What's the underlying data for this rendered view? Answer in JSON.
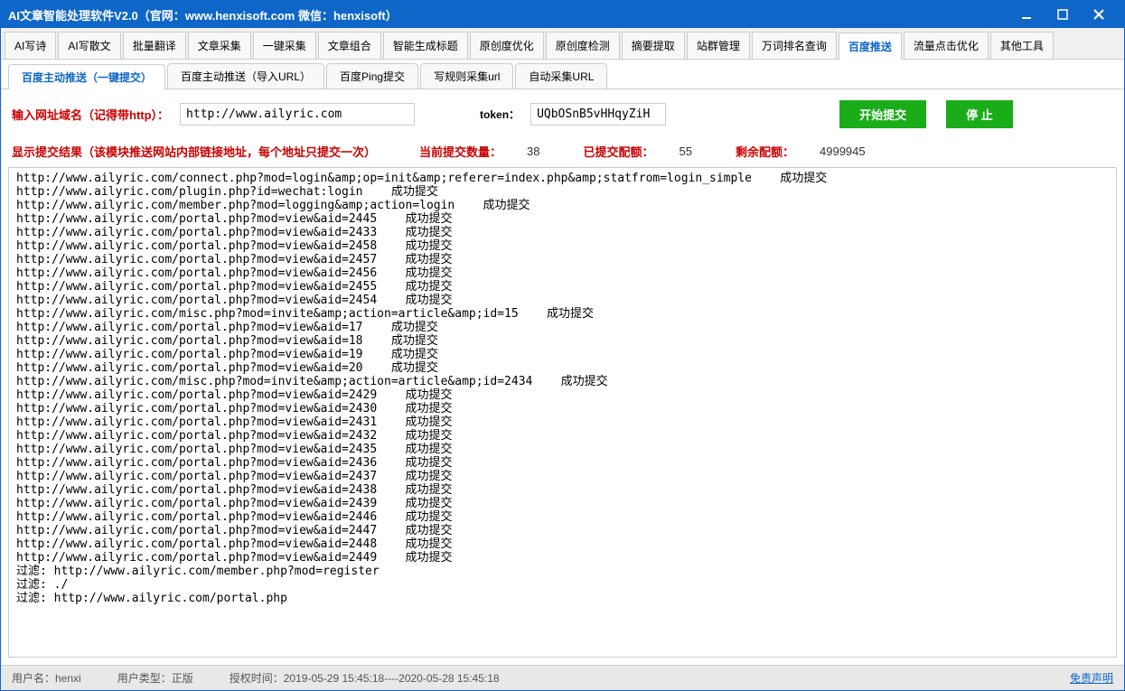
{
  "title": "AI文章智能处理软件V2.0（官网：www.henxisoft.com  微信：henxisoft）",
  "mainTabs": [
    "AI写诗",
    "AI写散文",
    "批量翻译",
    "文章采集",
    "一键采集",
    "文章组合",
    "智能生成标题",
    "原创度优化",
    "原创度检测",
    "摘要提取",
    "站群管理",
    "万词排名查询",
    "百度推送",
    "流量点击优化",
    "其他工具"
  ],
  "mainTabActive": 12,
  "subTabs": [
    "百度主动推送（一键提交）",
    "百度主动推送（导入URL）",
    "百度Ping提交",
    "写规则采集url",
    "自动采集URL"
  ],
  "subTabActive": 0,
  "form": {
    "urlLabel": "输入网址域名（记得带http）：",
    "urlValue": "http://www.ailyric.com",
    "tokenLabel": "token：",
    "tokenValue": "UQbOSnB5vHHqyZiH",
    "startBtn": "开始提交",
    "stopBtn": "停  止"
  },
  "stats": {
    "resultLabel": "显示提交结果（该模块推送网站内部链接地址，每个地址只提交一次）",
    "currentLabel": "当前提交数量：",
    "currentValue": "38",
    "submittedLabel": "已提交配额：",
    "submittedValue": "55",
    "remainLabel": "剩余配额：",
    "remainValue": "4999945"
  },
  "logLines": [
    "http://www.ailyric.com/connect.php?mod=login&amp;op=init&amp;referer=index.php&amp;statfrom=login_simple    成功提交",
    "http://www.ailyric.com/plugin.php?id=wechat:login    成功提交",
    "http://www.ailyric.com/member.php?mod=logging&amp;action=login    成功提交",
    "http://www.ailyric.com/portal.php?mod=view&aid=2445    成功提交",
    "http://www.ailyric.com/portal.php?mod=view&aid=2433    成功提交",
    "http://www.ailyric.com/portal.php?mod=view&aid=2458    成功提交",
    "http://www.ailyric.com/portal.php?mod=view&aid=2457    成功提交",
    "http://www.ailyric.com/portal.php?mod=view&aid=2456    成功提交",
    "http://www.ailyric.com/portal.php?mod=view&aid=2455    成功提交",
    "http://www.ailyric.com/portal.php?mod=view&aid=2454    成功提交",
    "http://www.ailyric.com/misc.php?mod=invite&amp;action=article&amp;id=15    成功提交",
    "http://www.ailyric.com/portal.php?mod=view&aid=17    成功提交",
    "http://www.ailyric.com/portal.php?mod=view&aid=18    成功提交",
    "http://www.ailyric.com/portal.php?mod=view&aid=19    成功提交",
    "http://www.ailyric.com/portal.php?mod=view&aid=20    成功提交",
    "http://www.ailyric.com/misc.php?mod=invite&amp;action=article&amp;id=2434    成功提交",
    "http://www.ailyric.com/portal.php?mod=view&aid=2429    成功提交",
    "http://www.ailyric.com/portal.php?mod=view&aid=2430    成功提交",
    "http://www.ailyric.com/portal.php?mod=view&aid=2431    成功提交",
    "http://www.ailyric.com/portal.php?mod=view&aid=2432    成功提交",
    "http://www.ailyric.com/portal.php?mod=view&aid=2435    成功提交",
    "http://www.ailyric.com/portal.php?mod=view&aid=2436    成功提交",
    "http://www.ailyric.com/portal.php?mod=view&aid=2437    成功提交",
    "http://www.ailyric.com/portal.php?mod=view&aid=2438    成功提交",
    "http://www.ailyric.com/portal.php?mod=view&aid=2439    成功提交",
    "http://www.ailyric.com/portal.php?mod=view&aid=2446    成功提交",
    "http://www.ailyric.com/portal.php?mod=view&aid=2447    成功提交",
    "http://www.ailyric.com/portal.php?mod=view&aid=2448    成功提交",
    "http://www.ailyric.com/portal.php?mod=view&aid=2449    成功提交",
    "",
    "过滤: http://www.ailyric.com/member.php?mod=register",
    "过滤: ./",
    "过滤: http://www.ailyric.com/portal.php"
  ],
  "status": {
    "userLabel": "用户名：",
    "userValue": "henxi",
    "typeLabel": "用户类型：",
    "typeValue": "正版",
    "authLabel": "授权时间：",
    "authValue": "2019-05-29 15:45:18----2020-05-28 15:45:18",
    "disclaimer": "免责声明"
  }
}
